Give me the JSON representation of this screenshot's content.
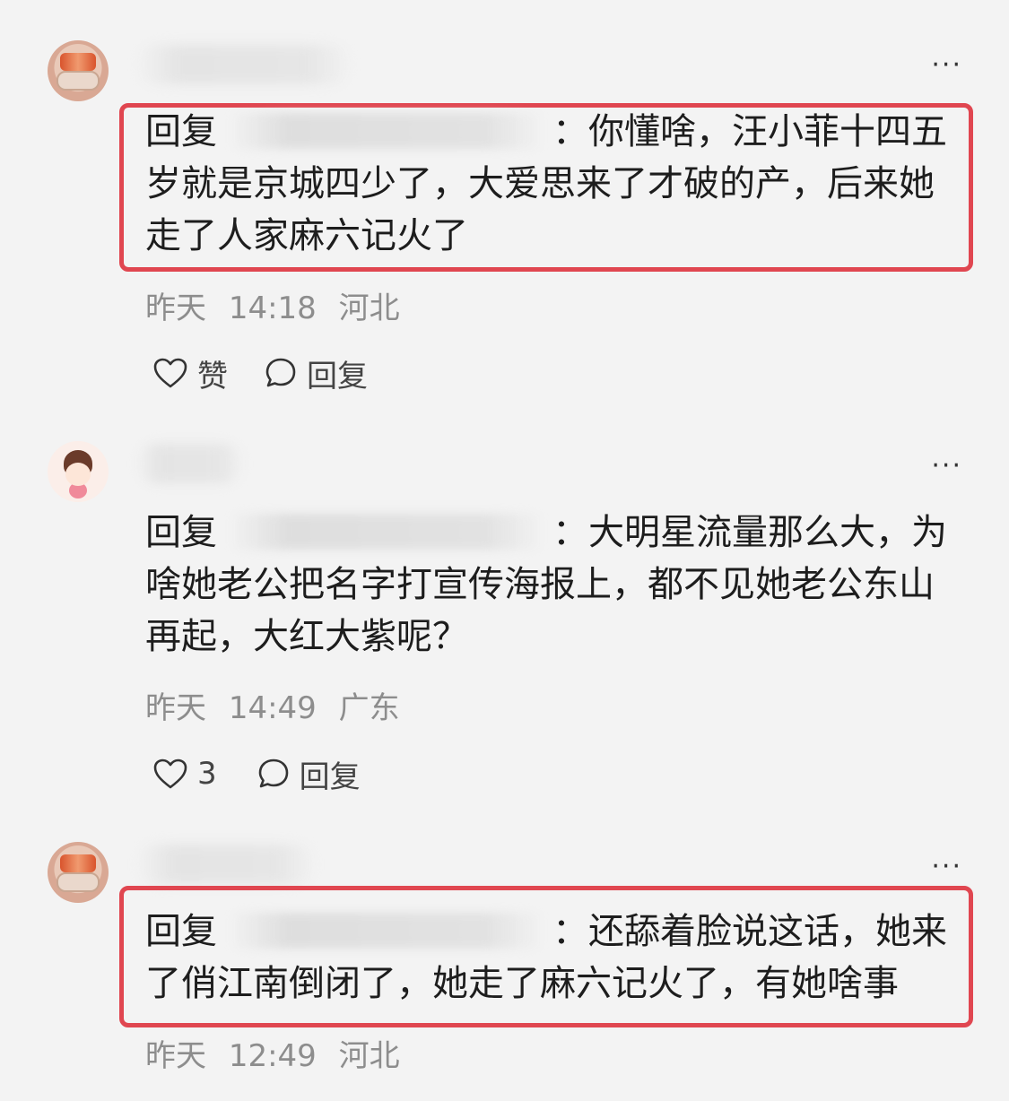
{
  "comments": [
    {
      "reply_prefix": "回复",
      "colon": "：",
      "text": "你懂啥，汪小菲十四五岁就是京城四少了，大爱思来了才破的产，后来她走了人家麻六记火了",
      "date": "昨天",
      "time": "14:18",
      "location": "河北",
      "like_label": "赞",
      "reply_label": "回复",
      "highlighted": true
    },
    {
      "reply_prefix": "回复",
      "colon": "：",
      "text": "大明星流量那么大，为啥她老公把名字打宣传海报上，都不见她老公东山再起，大红大紫呢？",
      "date": "昨天",
      "time": "14:49",
      "location": "广东",
      "like_label": "3",
      "reply_label": "回复",
      "highlighted": false
    },
    {
      "reply_prefix": "回复",
      "colon": "：",
      "text": "还舔着脸说这话，她来了俏江南倒闭了，她走了麻六记火了，有她啥事",
      "date": "昨天",
      "time": "12:49",
      "location": "河北",
      "highlighted": true
    }
  ],
  "more_label": "···",
  "colors": {
    "highlight": "#e04650",
    "background": "#f3f3f3",
    "meta_text": "#8d8d8d"
  },
  "icons": {
    "like": "heart-icon",
    "reply": "chat-bubble-icon",
    "more": "ellipsis-icon"
  }
}
